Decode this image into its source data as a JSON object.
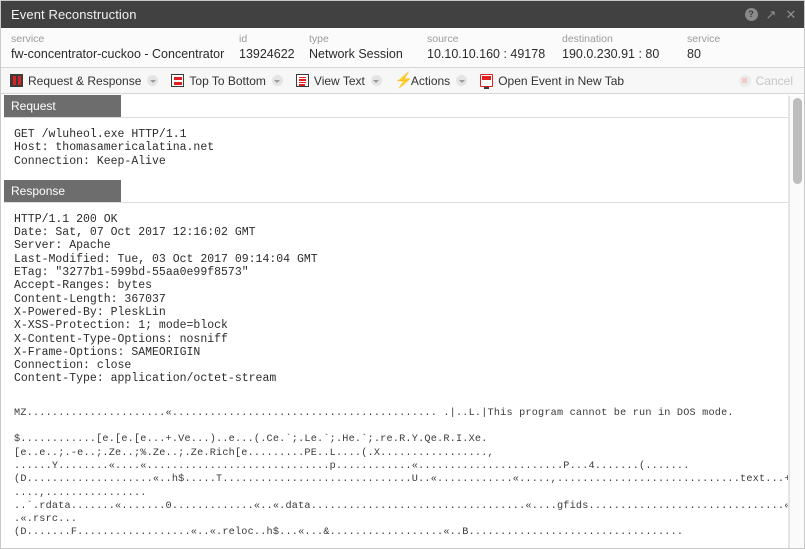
{
  "window": {
    "title": "Event Reconstruction",
    "help_icon": "help-icon",
    "expand_icon": "expand-icon",
    "close_icon": "close-icon",
    "close_glyph": "✕",
    "expand_glyph": "↗",
    "help_glyph": "?"
  },
  "meta": {
    "fields": [
      {
        "label": "service",
        "value": "fw-concentrator-cuckoo - Concentrator"
      },
      {
        "label": "id",
        "value": "13924622"
      },
      {
        "label": "type",
        "value": "Network Session"
      },
      {
        "label": "source",
        "value": "10.10.10.160 : 49178"
      },
      {
        "label": "destination",
        "value": "190.0.230.91 : 80"
      },
      {
        "label": "service",
        "value": "80"
      }
    ]
  },
  "toolbar": {
    "items": [
      {
        "label": "Request & Response",
        "icon": "request-response-icon",
        "has_caret": true
      },
      {
        "label": "Top To Bottom",
        "icon": "top-to-bottom-icon",
        "has_caret": true
      },
      {
        "label": "View Text",
        "icon": "view-text-icon",
        "has_caret": true
      },
      {
        "label": "Actions",
        "icon": "actions-lightning-icon",
        "has_caret": true
      },
      {
        "label": "Open Event in New Tab",
        "icon": "open-new-tab-icon",
        "has_caret": false
      }
    ],
    "cancel_label": "Cancel",
    "accent_color": "#e02020"
  },
  "sections": {
    "request": {
      "tab_label": "Request",
      "body": "GET /wluheol.exe HTTP/1.1\nHost: thomasamericalatina.net\nConnection: Keep-Alive"
    },
    "response": {
      "tab_label": "Response",
      "headers": "HTTP/1.1 200 OK\nDate: Sat, 07 Oct 2017 12:16:02 GMT\nServer: Apache\nLast-Modified: Tue, 03 Oct 2017 09:14:04 GMT\nETag: \"3277b1-599bd-55aa0e99f8573\"\nAccept-Ranges: bytes\nContent-Length: 367037\nX-Powered-By: PleskLin\nX-XSS-Protection: 1; mode=block\nX-Content-Type-Options: nosniff\nX-Frame-Options: SAMEORIGIN\nConnection: close\nContent-Type: application/octet-stream",
      "payload": "MZ......................«.......................................... .|..L.|This program cannot be run in DOS mode.\n\n$............[e.[e.[e...+.Ve...)..e...(.Ce.`;.Le.`;.He.`;.re.R.Y.Qe.R.I.Xe.\n[e..e..;.-e..;.Ze..;%.Ze..;.Ze.Rich[e.........PE..L....(.X.................,\n......Y........«....«.............................p............«.......................P...4.......(.......\n(D....................«..h$.....T..............................U..«............«.....,.............................text...+...\n....,................\n..`.rdata.......«.......0.............«..«.data..................................«....gfids...............................«.\n.«.rsrc...\n(D.......F..................«..«.reloc..h$...«...&..................«..B.................................."
    }
  },
  "scrollbar": {
    "name": "vertical-scrollbar"
  }
}
